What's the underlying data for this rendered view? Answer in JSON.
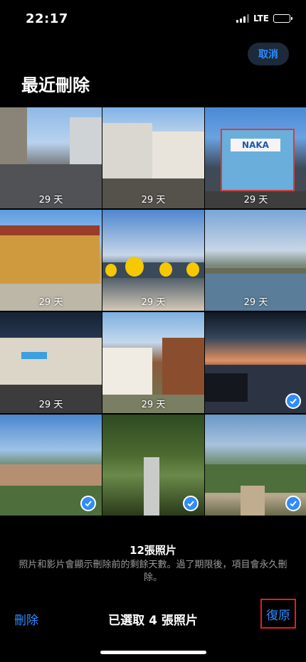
{
  "status_bar": {
    "time": "22:17",
    "network": "LTE"
  },
  "header": {
    "cancel_label": "取消",
    "title": "最近刪除"
  },
  "photos": [
    {
      "days": "29 天",
      "selected": false
    },
    {
      "days": "29 天",
      "selected": false
    },
    {
      "days": "29 天",
      "selected": false,
      "sign": "NAKA"
    },
    {
      "days": "29 天",
      "selected": false
    },
    {
      "days": "29 天",
      "selected": false
    },
    {
      "days": "29 天",
      "selected": false
    },
    {
      "days": "29 天",
      "selected": false
    },
    {
      "days": "29 天",
      "selected": false
    },
    {
      "days": "",
      "selected": true
    },
    {
      "days": "",
      "selected": true
    },
    {
      "days": "",
      "selected": true
    },
    {
      "days": "",
      "selected": true
    }
  ],
  "footer": {
    "count": "12張照片",
    "note": "照片和影片會顯示刪除前的剩餘天數。過了期限後，項目會永久刪除。"
  },
  "toolbar": {
    "delete_label": "刪除",
    "selected_label": "已選取 4 張照片",
    "restore_label": "復原"
  },
  "colors": {
    "accent": "#2f8cff",
    "highlight": "#e02020"
  }
}
